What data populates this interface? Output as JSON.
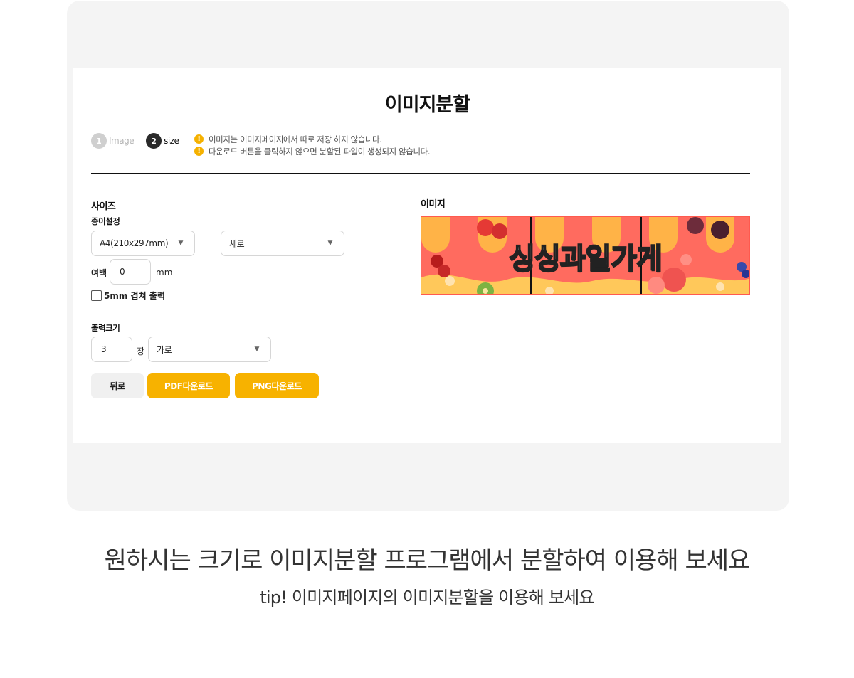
{
  "panel": {
    "title": "이미지분할",
    "steps": [
      {
        "num": "1",
        "label": "Image",
        "active": false
      },
      {
        "num": "2",
        "label": "size",
        "active": true
      }
    ],
    "notices": [
      "이미지는 이미지페이지에서 따로 저장 하지 않습니다.",
      "다운로드 버튼을 클릭하지 않으면 분할된 파일이 생성되지 않습니다."
    ]
  },
  "size_section": {
    "title": "사이즈",
    "paper_label": "종이설정",
    "paper_size": "A4(210x297mm)",
    "orientation": "세로",
    "margin_label": "여백",
    "margin_value": "0",
    "margin_unit": "mm",
    "overlap_label": "5mm 겹쳐 출력",
    "overlap_checked": false
  },
  "output_section": {
    "title": "출력크기",
    "count_value": "3",
    "count_unit": "장",
    "direction": "가로"
  },
  "buttons": {
    "back": "뒤로",
    "pdf": "PDF다운로드",
    "png": "PNG다운로드"
  },
  "image_section": {
    "title": "이미지",
    "banner_text": "싱싱과일가게",
    "split_count": 3
  },
  "captions": {
    "main": "원하시는 크기로 이미지분할 프로그램에서 분할하여 이용해 보세요",
    "tip": "tip! 이미지페이지의 이미지분할을 이용해 보세요"
  },
  "colors": {
    "accent": "#f7b200",
    "banner_red": "#ff6b5f",
    "banner_orange": "#ffb347",
    "banner_yellow": "#ffc85a"
  }
}
